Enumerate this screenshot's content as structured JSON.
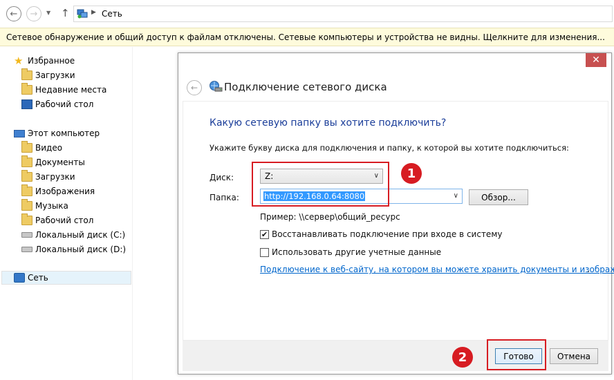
{
  "address_bar": {
    "back_label": "←",
    "forward_label": "→",
    "path_label": "Сеть"
  },
  "infobar": {
    "text": "Сетевое обнаружение и общий доступ к файлам отключены. Сетевые компьютеры и устройства не видны. Щелкните для изменения..."
  },
  "sidebar": {
    "favorites": {
      "label": "Избранное",
      "items": [
        {
          "label": "Загрузки",
          "icon": "downloads-folder-icon"
        },
        {
          "label": "Недавние места",
          "icon": "recent-places-icon"
        },
        {
          "label": "Рабочий стол",
          "icon": "desktop-icon"
        }
      ]
    },
    "computer": {
      "label": "Этот компьютер",
      "items": [
        {
          "label": "Видео",
          "icon": "video-folder-icon"
        },
        {
          "label": "Документы",
          "icon": "documents-folder-icon"
        },
        {
          "label": "Загрузки",
          "icon": "downloads-folder-icon"
        },
        {
          "label": "Изображения",
          "icon": "pictures-folder-icon"
        },
        {
          "label": "Музыка",
          "icon": "music-folder-icon"
        },
        {
          "label": "Рабочий стол",
          "icon": "desktop-folder-icon"
        },
        {
          "label": "Локальный диск (C:)",
          "icon": "system-drive-icon"
        },
        {
          "label": "Локальный диск (D:)",
          "icon": "drive-icon"
        }
      ]
    },
    "network": {
      "label": "Сеть"
    }
  },
  "dialog": {
    "close_label": "✕",
    "title": "Подключение сетевого диска",
    "heading": "Какую сетевую папку вы хотите подключить?",
    "subtext": "Укажите букву диска для подключения и папку, к которой вы хотите подключиться:",
    "drive_label": "Диск:",
    "drive_value": "Z:",
    "folder_label": "Папка:",
    "folder_value": "http://192.168.0.64:8080",
    "browse_label": "Обзор...",
    "example": "Пример: \\\\сервер\\общий_ресурс",
    "reconnect_label": "Восстанавливать подключение при входе в систему",
    "reconnect_checked": true,
    "other_creds_label": "Использовать другие учетные данные",
    "other_creds_checked": false,
    "web_link": "Подключение к веб-сайту, на котором вы можете хранить документы и изображения",
    "done_label": "Готово",
    "cancel_label": "Отмена"
  },
  "annotations": {
    "badge1": "1",
    "badge2": "2",
    "color": "#d71c22"
  }
}
